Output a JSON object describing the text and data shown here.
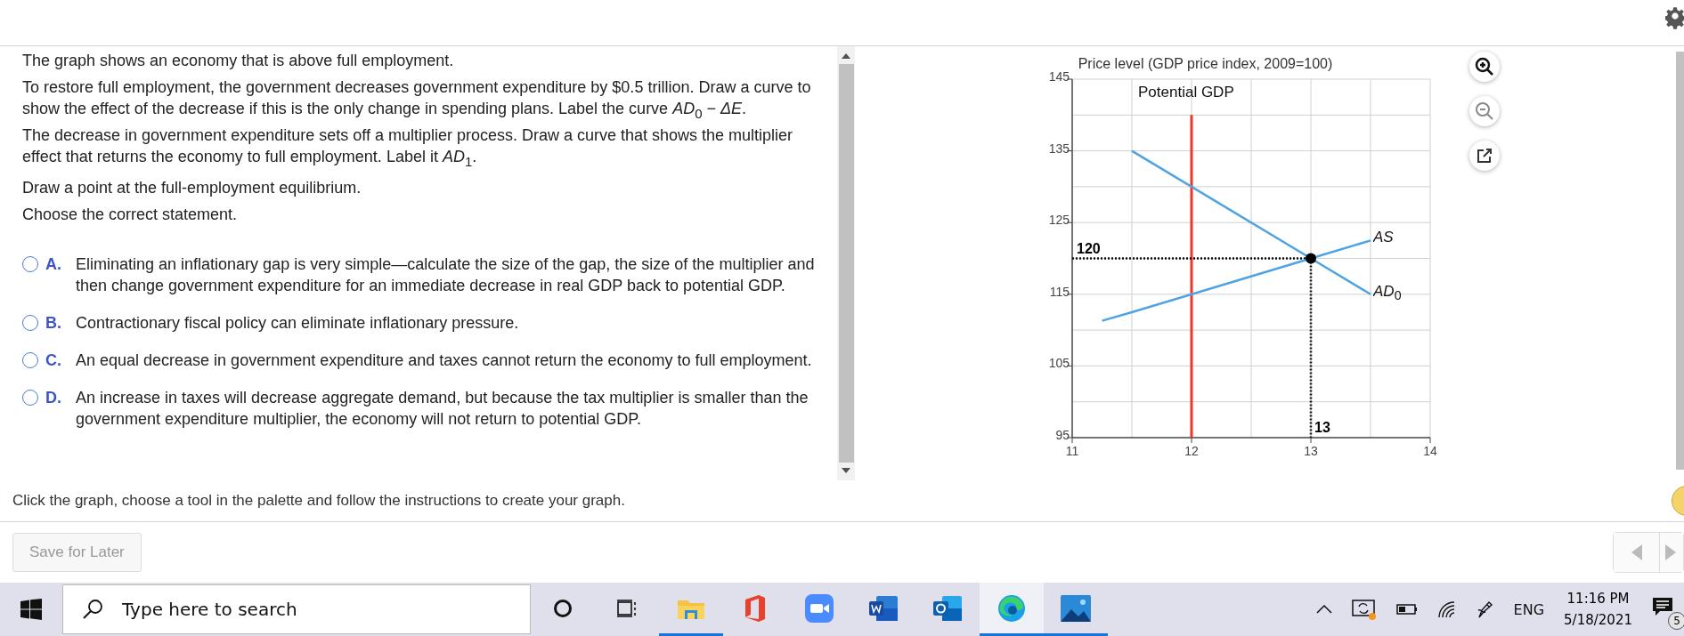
{
  "question": {
    "paragraphs": [
      "The graph shows an economy that is above full employment.",
      "To restore full employment, the government decreases government expenditure by $0.5 trillion. Draw a curve to show the effect of the decrease if this is the only change in spending plans. Label the curve *AD*$_{0}$ − *ΔE*.",
      "The decrease in government expenditure sets off a multiplier process. Draw a curve that shows the multiplier effect that returns the economy to full employment. Label it *AD*$_{1}$.",
      "Draw a point at the full-employment equilibrium.",
      "Choose the correct statement."
    ],
    "options": [
      {
        "letter": "A.",
        "text": "Eliminating an inflationary gap is very simple—calculate the size of the gap, the size of the multiplier and then change government expenditure for an immediate decrease in real GDP back to potential GDP.",
        "selected": false
      },
      {
        "letter": "B.",
        "text": "Contractionary fiscal policy can eliminate inflationary pressure.",
        "selected": false
      },
      {
        "letter": "C.",
        "text": "An equal decrease in government expenditure and taxes cannot return the economy to full employment.",
        "selected": false
      },
      {
        "letter": "D.",
        "text": "An increase in taxes will decrease aggregate demand, but because the tax multiplier is smaller than the government expenditure multiplier, the economy will not return to potential GDP.",
        "selected": false
      }
    ]
  },
  "graph": {
    "chart_data": {
      "type": "line",
      "ylabel": "Price level (GDP price index, 2009=100)",
      "xlim": [
        11,
        14
      ],
      "ylim": [
        95,
        145
      ],
      "xticks": [
        11,
        12,
        13,
        14
      ],
      "yticks": [
        95,
        105,
        115,
        125,
        135,
        145
      ],
      "x": [
        11.25,
        11.5,
        13,
        13.5
      ],
      "series": [
        {
          "name": "*AD*$_{0}$",
          "color": "#4fa3e3",
          "values": [
            null,
            135,
            120,
            115
          ]
        },
        {
          "name": "*AS*",
          "color": "#4fa3e3",
          "values": [
            111.3,
            112.5,
            120,
            122.5
          ]
        }
      ],
      "grid": true,
      "ref_lines": [
        {
          "axis": "x",
          "value": 12,
          "label": "Potential GDP",
          "color": "#e8392c"
        }
      ],
      "annotations": [
        {
          "text": "120",
          "x": 13,
          "y": 120
        },
        {
          "text": "13",
          "x": 13,
          "y": 120
        }
      ]
    }
  },
  "instruction": "Click the graph, choose a tool in the palette and follow the instructions to create your graph.",
  "save_button": "Save for Later",
  "taskbar": {
    "search_placeholder": "Type here to search",
    "apps": [
      {
        "kind": "cortana",
        "running": false,
        "selected": false
      },
      {
        "kind": "taskview",
        "running": false,
        "selected": false
      },
      {
        "kind": "explorer",
        "running": true,
        "selected": false
      },
      {
        "kind": "office",
        "running": false,
        "selected": false
      },
      {
        "kind": "zoom",
        "running": false,
        "selected": false
      },
      {
        "kind": "word",
        "running": false,
        "selected": false
      },
      {
        "kind": "outlook",
        "running": false,
        "selected": false
      },
      {
        "kind": "edge",
        "running": true,
        "selected": true
      },
      {
        "kind": "photos",
        "running": true,
        "selected": false
      }
    ],
    "language": "ENG",
    "time": "11:16 PM",
    "date": "5/18/2021",
    "notifications": "5"
  }
}
